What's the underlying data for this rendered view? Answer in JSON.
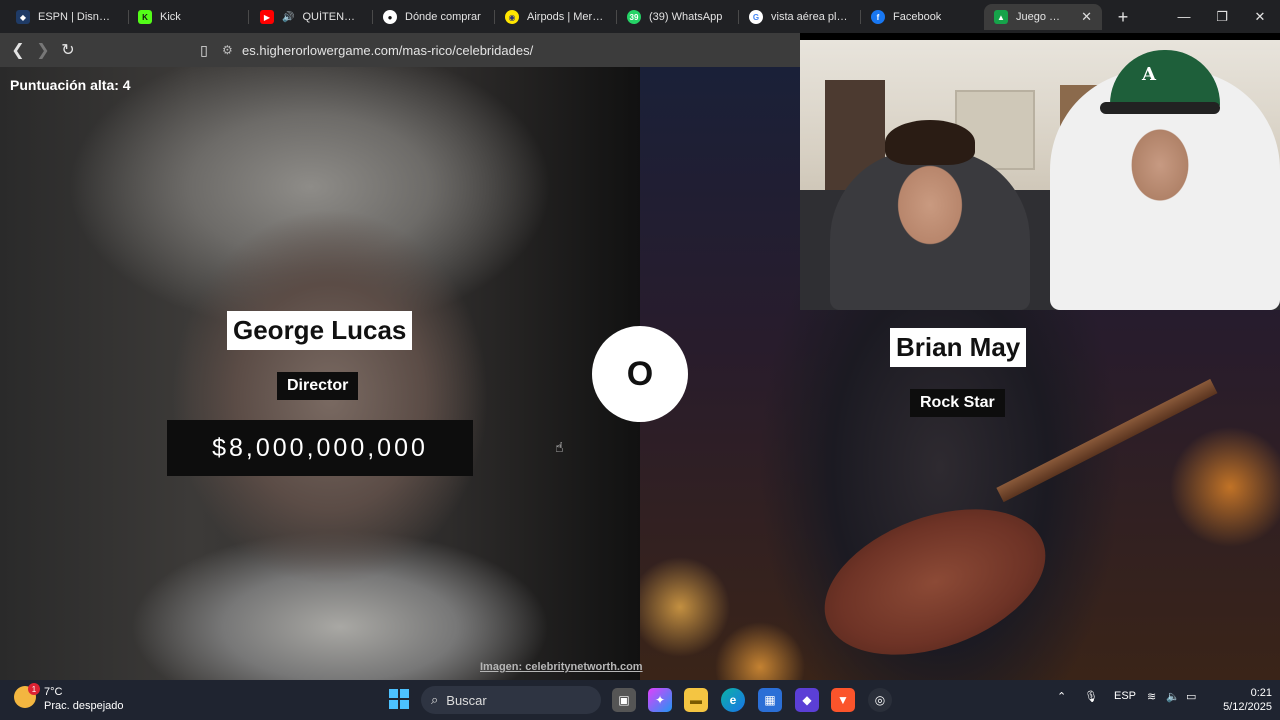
{
  "browser": {
    "tabs": [
      {
        "title": "ESPN | Disney+",
        "icon": "espn-icon",
        "color": "#1f3b66",
        "active": false
      },
      {
        "title": "Kick",
        "icon": "kick-icon",
        "color": "#53fc18",
        "active": false
      },
      {
        "title": "QUÍTENME EL",
        "icon": "youtube-icon",
        "color": "#ff0000",
        "active": false
      },
      {
        "title": "Dónde comprar",
        "icon": "site-icon",
        "color": "#ffffff",
        "active": false
      },
      {
        "title": "Airpods | Mercado",
        "icon": "mercadolibre-icon",
        "color": "#ffe600",
        "active": false
      },
      {
        "title": "(39) WhatsApp",
        "icon": "whatsapp-icon",
        "color": "#25d366",
        "active": false
      },
      {
        "title": "vista aérea plaza",
        "icon": "google-icon",
        "color": "#ffffff",
        "active": false
      },
      {
        "title": "Facebook",
        "icon": "facebook-icon",
        "color": "#1877f2",
        "active": false
      },
      {
        "title": "Juego más alt",
        "icon": "game-icon",
        "color": "#16a34a",
        "active": true
      }
    ],
    "url": "es.higherorlowergame.com/mas-rico/celebridades/"
  },
  "game": {
    "high_score_label": "Puntuación alta: 4",
    "vs_label": "O",
    "image_credit": "Imagen: celebritynetworth.com",
    "left": {
      "name": "George Lucas",
      "role": "Director",
      "net_worth": "$8,000,000,000"
    },
    "right": {
      "name": "Brian May",
      "role": "Rock Star"
    }
  },
  "taskbar": {
    "weather_temp": "7°C",
    "weather_condition": "Prac. despejado",
    "weather_badge": "1",
    "search_placeholder": "Buscar",
    "language": "ESP",
    "time": "0:21",
    "date": "5/12/2025",
    "accent": "#4cc2ff"
  }
}
